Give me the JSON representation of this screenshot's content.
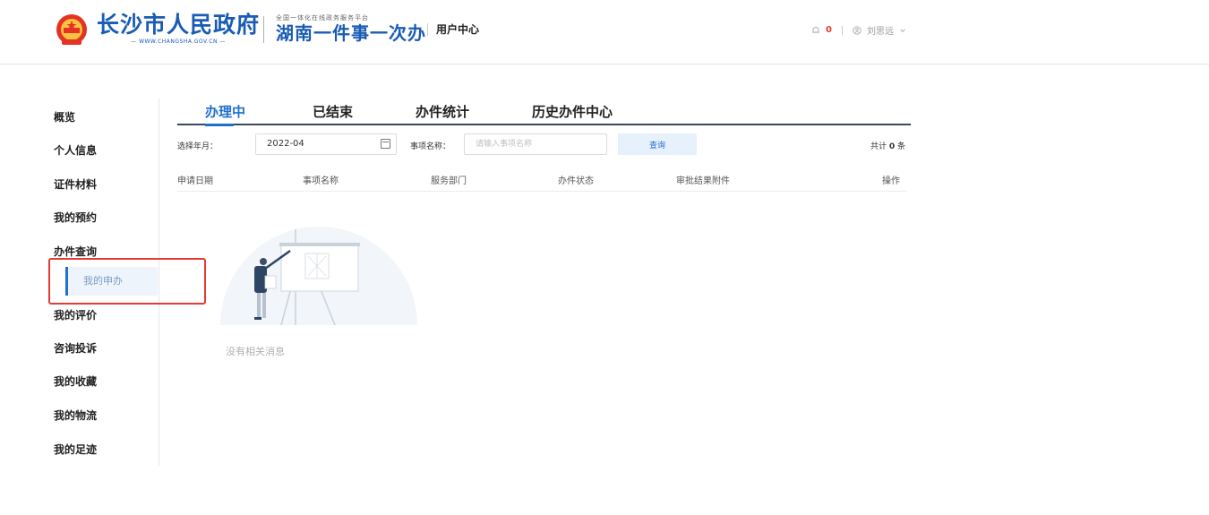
{
  "header": {
    "gov_name": "长沙市人民政府",
    "gov_url": "— WWW.CHANGSHA.GOV.CN —",
    "platform_sub": "全国一体化在线政务服务平台",
    "platform_name": "湖南一件事一次办",
    "user_center": "用户中心",
    "notification_count": "0",
    "username": "刘思远",
    "brand_color": "#1a5cb4"
  },
  "sidebar": {
    "items": [
      {
        "label": "概览"
      },
      {
        "label": "个人信息"
      },
      {
        "label": "证件材料"
      },
      {
        "label": "我的预约"
      },
      {
        "label": "办件查询"
      },
      {
        "label": "我的申办"
      },
      {
        "label": "我的评价"
      },
      {
        "label": "咨询投诉"
      },
      {
        "label": "我的收藏"
      },
      {
        "label": "我的物流"
      },
      {
        "label": "我的足迹"
      }
    ],
    "active": "我的申办"
  },
  "tabs": [
    {
      "label": "办理中",
      "active": true
    },
    {
      "label": "已结束",
      "active": false
    },
    {
      "label": "办件统计",
      "active": false
    },
    {
      "label": "历史办件中心",
      "active": false
    }
  ],
  "filter": {
    "month_label": "选择年月：",
    "month_value": "2022-04",
    "name_label": "事项名称：",
    "name_placeholder": "请输入事项名称",
    "query_label": "查询",
    "total_prefix": "共计",
    "total_count": "0",
    "total_suffix": "条"
  },
  "table": {
    "columns": [
      "申请日期",
      "事项名称",
      "服务部门",
      "办件状态",
      "审批结果附件",
      "操作"
    ],
    "rows": []
  },
  "empty": {
    "message": "没有相关消息"
  },
  "colors": {
    "accent": "#1f6fd1",
    "highlight": "#e53935"
  }
}
